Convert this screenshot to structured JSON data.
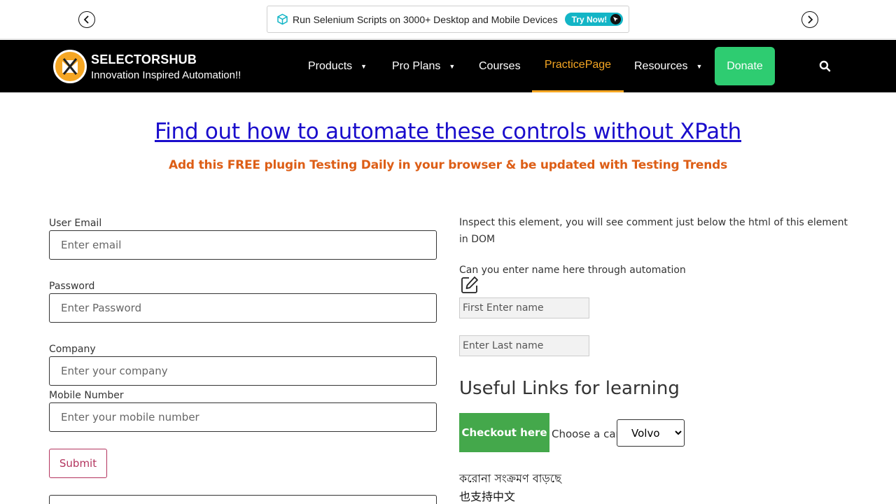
{
  "promo": {
    "text": "Run Selenium Scripts on 3000+ Desktop and Mobile Devices",
    "cta": "Try Now!"
  },
  "brand": {
    "name": "SELECTORSHUB",
    "tagline": "Innovation Inspired Automation!!"
  },
  "nav": {
    "items": [
      {
        "label": "Products",
        "caret": "▼"
      },
      {
        "label": "Pro Plans",
        "caret": "▼"
      },
      {
        "label": "Courses"
      },
      {
        "label": "PracticePage"
      },
      {
        "label": "Resources",
        "caret": "▼"
      }
    ],
    "donate": "Donate",
    "active_color": "#f5a623"
  },
  "hero": {
    "title": "Find out how to automate these controls without XPath",
    "subtitle": "Add this FREE plugin Testing Daily in your browser & be updated with Testing Trends"
  },
  "form": {
    "email_label": "User Email",
    "email_placeholder": "Enter email",
    "password_label": "Password",
    "password_placeholder": "Enter Password",
    "company_label": "Company",
    "company_placeholder": "Enter your company",
    "mobile_label": "Mobile Number",
    "mobile_placeholder": "Enter your mobile number",
    "submit": "Submit"
  },
  "right": {
    "inspect_text": "Inspect this element, you will see comment just below the html of this element in DOM",
    "enter_name_text": "Can you enter name here through automation",
    "first_name_placeholder": "First Enter name",
    "last_name_placeholder": "Enter Last name",
    "links_heading": "Useful Links for learning",
    "checkout": "Checkout here",
    "car_label": "Choose a car:",
    "car_selected": "Volvo",
    "bengali_text": "করোনা সংক্রমণ বাড়ছে",
    "chinese_text": "也支持中文"
  },
  "colors": {
    "headline": "#1a0dcc",
    "subline": "#dd5e16",
    "donate": "#2ecc71",
    "checkout": "#44a84b",
    "submit_border": "#b3345e"
  }
}
